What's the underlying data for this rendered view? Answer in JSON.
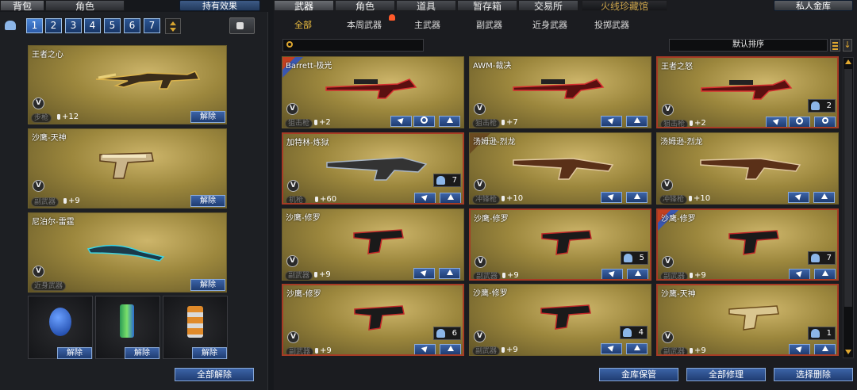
{
  "left_tabs": [
    "背包",
    "角色"
  ],
  "effect_button": "持有效果",
  "pages": [
    "1",
    "2",
    "3",
    "4",
    "5",
    "6",
    "7"
  ],
  "main_tabs": [
    "武器",
    "角色",
    "道具",
    "暂存箱",
    "交易所",
    "火线珍藏馆"
  ],
  "private_vault_button": "私人金库",
  "sub_tabs": [
    "全部",
    "本周武器",
    "主武器",
    "副武器",
    "近身武器",
    "投掷武器"
  ],
  "sort_label": "默认排序",
  "equipped": [
    {
      "name": "王者之心",
      "category": "步枪",
      "plus": "+12",
      "unlock": "解除"
    },
    {
      "name": "沙鹰-天神",
      "category": "副武器",
      "plus": "+9",
      "unlock": "解除"
    },
    {
      "name": "尼泊尔-雷霆",
      "category": "近身武器",
      "plus": "",
      "unlock": "解除"
    }
  ],
  "throwables": [
    {
      "icon": "grenade-icon",
      "unlock": "解除"
    },
    {
      "icon": "smoke-grenade-icon",
      "unlock": "解除"
    },
    {
      "icon": "flashbang-icon",
      "unlock": "解除"
    }
  ],
  "unlock_all": "全部解除",
  "weapons": [
    {
      "name": "Barrett-极光",
      "category": "狙击枪",
      "plus": "+2",
      "count": ""
    },
    {
      "name": "AWM-裁决",
      "category": "狙击枪",
      "plus": "+7",
      "count": ""
    },
    {
      "name": "王者之怒",
      "category": "狙击枪",
      "plus": "+2",
      "count": "2"
    },
    {
      "name": "加特林-炼狱",
      "category": "机枪",
      "plus": "+60",
      "count": "7"
    },
    {
      "name": "汤姆逊-烈龙",
      "category": "冲锋枪",
      "plus": "+10",
      "count": ""
    },
    {
      "name": "汤姆逊-烈龙",
      "category": "冲锋枪",
      "plus": "+10",
      "count": ""
    },
    {
      "name": "沙鹰-修罗",
      "category": "副武器",
      "plus": "+9",
      "count": ""
    },
    {
      "name": "沙鹰-修罗",
      "category": "副武器",
      "plus": "+9",
      "count": "5"
    },
    {
      "name": "沙鹰-修罗",
      "category": "副武器",
      "plus": "+9",
      "count": "7"
    },
    {
      "name": "沙鹰-修罗",
      "category": "副武器",
      "plus": "+9",
      "count": "6"
    },
    {
      "name": "沙鹰-修罗",
      "category": "副武器",
      "plus": "+9",
      "count": "4"
    },
    {
      "name": "沙鹰-天神",
      "category": "副武器",
      "plus": "+9",
      "count": "1"
    }
  ],
  "vbadge": "V",
  "bottom_buttons": [
    "金库保管",
    "全部修理",
    "选择删除"
  ]
}
